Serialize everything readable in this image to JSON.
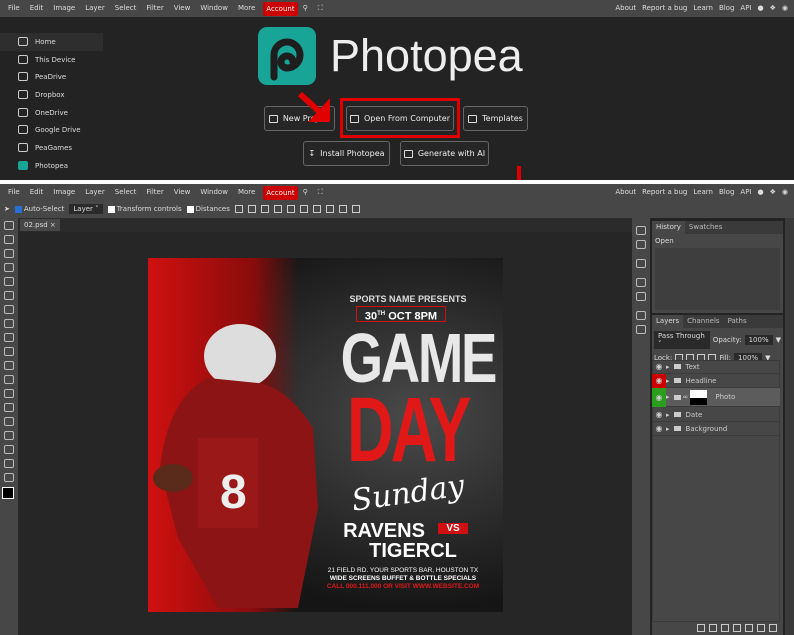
{
  "start": {
    "menu": [
      "File",
      "Edit",
      "Image",
      "Layer",
      "Select",
      "Filter",
      "View",
      "Window",
      "More"
    ],
    "account": "Account",
    "right_links": [
      "About",
      "Report a bug",
      "Learn",
      "Blog",
      "API"
    ],
    "sidebar": [
      {
        "label": "Home",
        "icon": "home-icon"
      },
      {
        "label": "This Device",
        "icon": "monitor-icon"
      },
      {
        "label": "PeaDrive",
        "icon": "drive-icon"
      },
      {
        "label": "Dropbox",
        "icon": "dropbox-icon"
      },
      {
        "label": "OneDrive",
        "icon": "cloud-icon"
      },
      {
        "label": "Google Drive",
        "icon": "google-drive-icon"
      },
      {
        "label": "PeaGames",
        "icon": "gamepad-icon"
      },
      {
        "label": "Photopea",
        "icon": "photopea-icon"
      }
    ],
    "logo_text": "Photopea",
    "buttons": {
      "new_project": "New Project",
      "open_computer": "Open From Computer",
      "templates": "Templates",
      "install": "Install Photopea",
      "generate_ai": "Generate with AI"
    },
    "accent": "#e00000",
    "brand": "#18a497"
  },
  "editor": {
    "menu": [
      "File",
      "Edit",
      "Image",
      "Layer",
      "Select",
      "Filter",
      "View",
      "Window",
      "More"
    ],
    "account": "Account",
    "right_links": [
      "About",
      "Report a bug",
      "Learn",
      "Blog",
      "API"
    ],
    "options": {
      "auto_select": "Auto-Select",
      "auto_select_checked": true,
      "layer_select": "Layer",
      "transform": "Transform controls",
      "distances": "Distances"
    },
    "doc_tab": "02.psd",
    "history": {
      "tabs": [
        "History",
        "Swatches"
      ],
      "items": [
        "Open"
      ]
    },
    "layers": {
      "tabs": [
        "Layers",
        "Channels",
        "Paths"
      ],
      "blend": "Pass Through",
      "opacity_label": "Opacity:",
      "opacity": "100%",
      "lock_label": "Lock:",
      "fill_label": "Fill:",
      "fill": "100%",
      "items": [
        {
          "name": "Text",
          "eye": "normal"
        },
        {
          "name": "Headline",
          "eye": "red"
        },
        {
          "name": "Photo",
          "eye": "green",
          "selected": true
        },
        {
          "name": "Date",
          "eye": "normal"
        },
        {
          "name": "Background",
          "eye": "normal"
        }
      ]
    }
  },
  "poster": {
    "presents_1": "SPORTS ",
    "presents_2": "NAME",
    "presents_3": " PRESENTS",
    "date": "30",
    "date_sup": "TH",
    "date_rest": " OCT 8PM",
    "game": "GAME",
    "day": "DAY",
    "sunday": "Sunday",
    "team1": "RAVENS",
    "vs": "VS",
    "team2": "TIGERCL",
    "address": "21 FIELD RD. YOUR SPORTS BAR, HOUSTON TX",
    "specials": "WIDE SCREENS BUFFET & BOTTLE SPECIALS",
    "call": "CALL 000.111.000 OR VISIT WWW.WEBSITE.COM",
    "jersey": "8"
  }
}
